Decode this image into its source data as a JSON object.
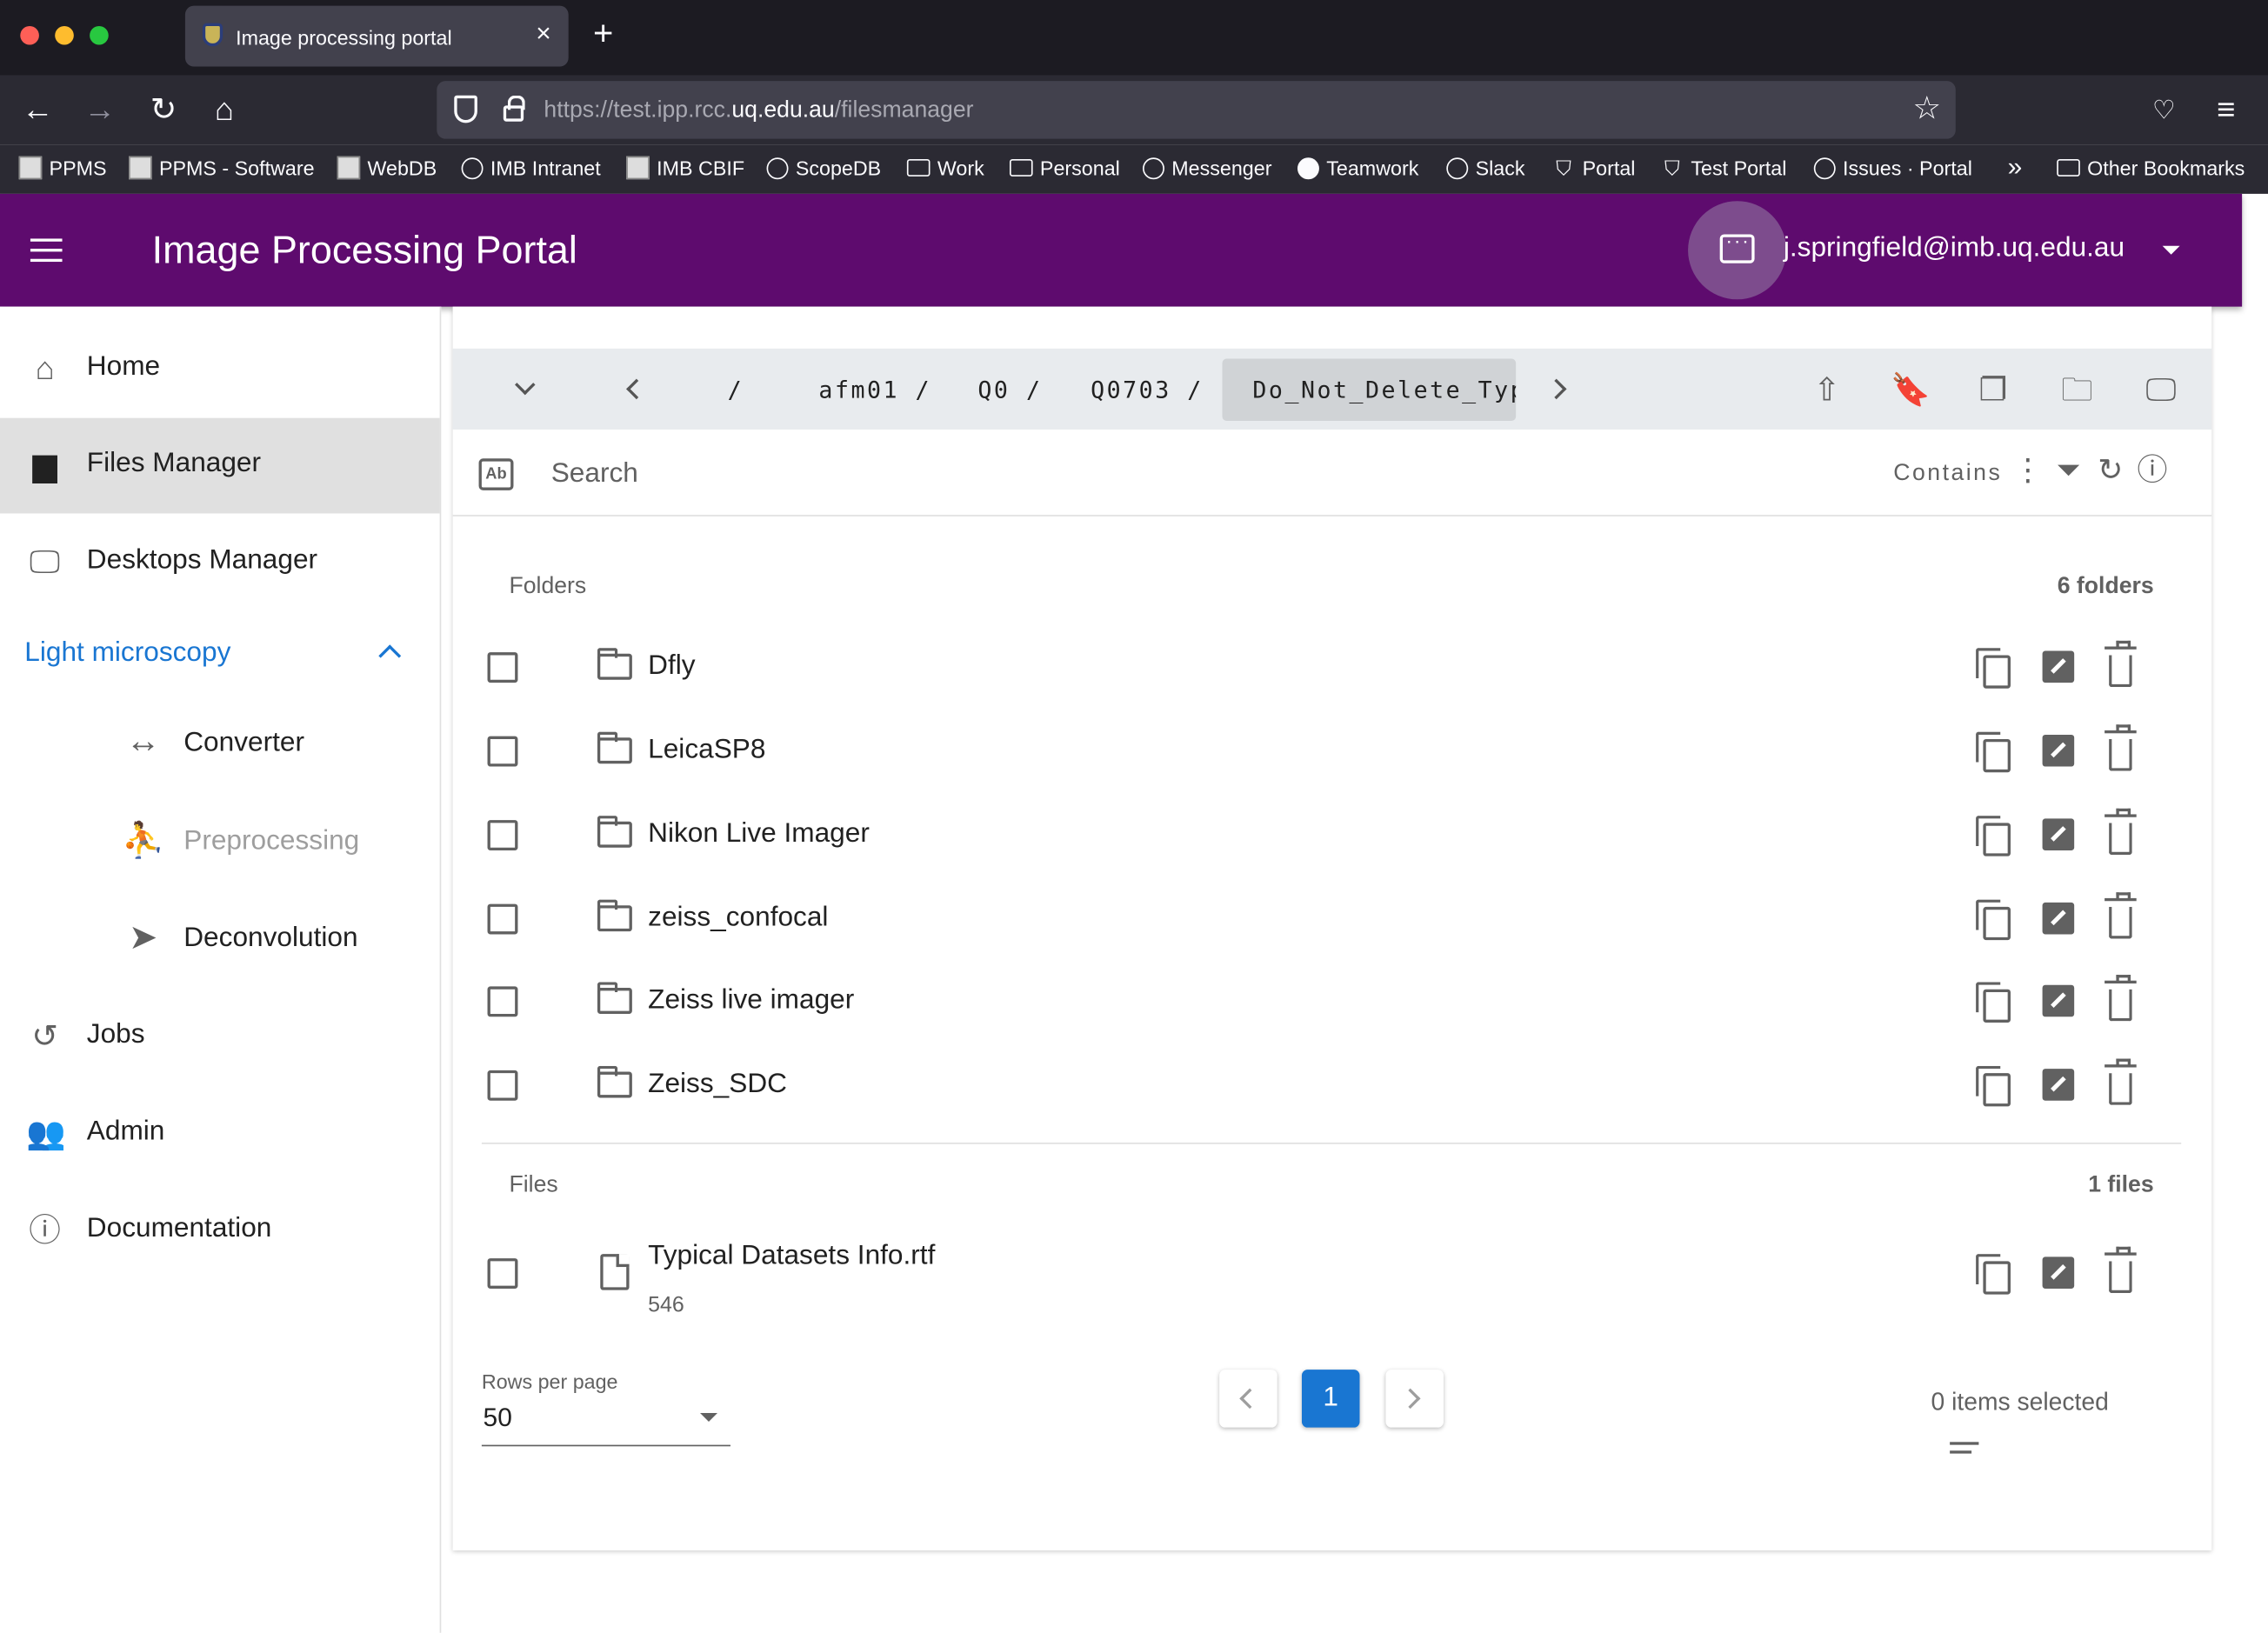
{
  "browser": {
    "tab_title": "Image processing portal",
    "tab_close": "×",
    "new_tab": "+",
    "url_prefix": "https://test.ipp.rcc.",
    "url_domain": "uq.edu.au",
    "url_path": "/filesmanager",
    "bookmarks": [
      "PPMS",
      "PPMS - Software",
      "WebDB",
      "IMB Intranet",
      "IMB CBIF",
      "ScopeDB",
      "Work",
      "Personal",
      "Messenger",
      "Teamwork",
      "Slack",
      "Portal",
      "Test Portal",
      "Issues · Portal"
    ],
    "overflow": "»",
    "other_bookmarks": "Other Bookmarks"
  },
  "app": {
    "title": "Image Processing Portal",
    "user_email": "j.springfield@imb.uq.edu.au",
    "accent_color": "#5e0b6e"
  },
  "sidebar": {
    "home": "Home",
    "files_manager": "Files Manager",
    "desktops_manager": "Desktops Manager",
    "group": "Light microscopy",
    "converter": "Converter",
    "preprocessing": "Preprocessing",
    "deconvolution": "Deconvolution",
    "jobs": "Jobs",
    "admin": "Admin",
    "documentation": "Documentation"
  },
  "breadcrumb": {
    "root": "/",
    "items": [
      "afm01 /",
      "Q0 /",
      "Q0703 /"
    ],
    "current": "Do_Not_Delete_Typical_Datasets"
  },
  "search": {
    "placeholder": "Search",
    "mode": "Contains"
  },
  "folders": {
    "label": "Folders",
    "count": "6 folders",
    "items": [
      "Dfly",
      "LeicaSP8",
      "Nikon Live Imager",
      "zeiss_confocal",
      "Zeiss live imager",
      "Zeiss_SDC"
    ]
  },
  "files": {
    "label": "Files",
    "count": "1 files",
    "items": [
      {
        "name": "Typical Datasets Info.rtf",
        "size": "546"
      }
    ]
  },
  "pagination": {
    "rows_label": "Rows per page",
    "rows_value": "50",
    "current_page": "1",
    "selected": "0 items selected"
  }
}
